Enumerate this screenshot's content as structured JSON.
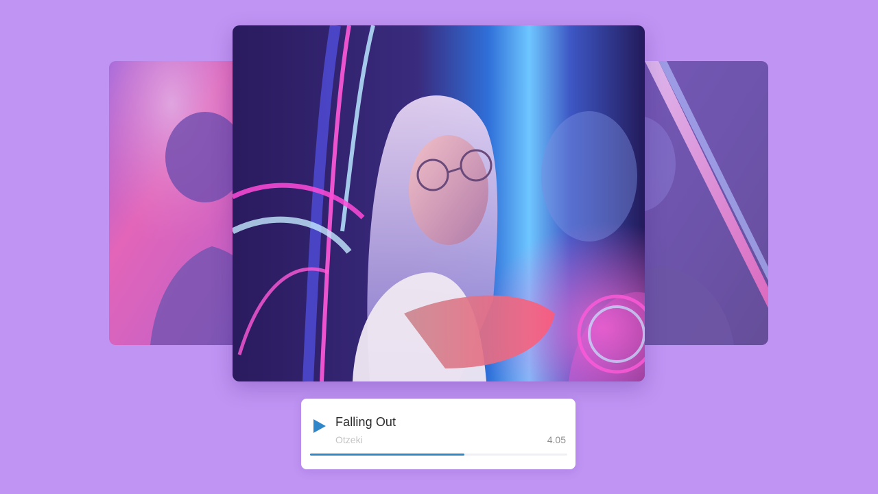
{
  "player": {
    "title": "Falling Out",
    "artist": "Otzeki",
    "time": "4.05",
    "progress": 0.6
  },
  "covers": [
    {
      "id": "left",
      "icon": "photo-cover"
    },
    {
      "id": "center",
      "icon": "photo-cover"
    },
    {
      "id": "right",
      "icon": "photo-cover"
    }
  ],
  "colors": {
    "background": "#c094f3",
    "accent": "#2f86c9",
    "title_text": "#2b2b2b",
    "artist_text": "#c4c4c4",
    "time_text": "#8f8f8f"
  }
}
